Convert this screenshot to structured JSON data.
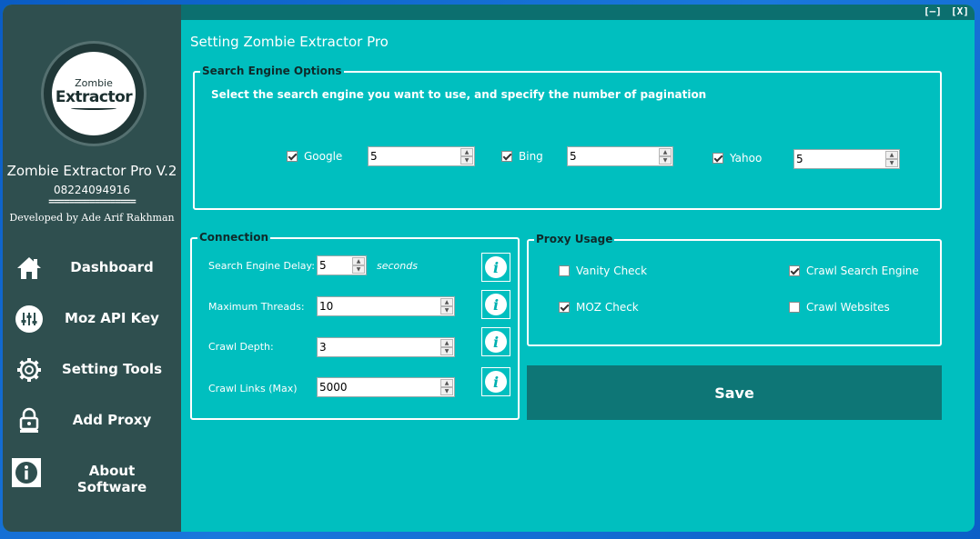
{
  "window": {
    "minimize_label": "[–]",
    "close_label": "[X]"
  },
  "sidebar": {
    "logo_small": "Zombie",
    "logo_big": "Extractor",
    "app_title": "Zombie Extractor Pro V.2",
    "phone": "08224094916",
    "separator": "=================",
    "developer": "Developed by Ade Arif Rakhman",
    "items": [
      {
        "label": "Dashboard",
        "icon": "home-icon"
      },
      {
        "label": "Moz API Key",
        "icon": "sliders-icon"
      },
      {
        "label": "Setting Tools",
        "icon": "gear-icon"
      },
      {
        "label": "Add Proxy",
        "icon": "proxy-lock-icon"
      },
      {
        "label": "About Software",
        "icon": "info-icon"
      }
    ]
  },
  "page_title": "Setting Zombie Extractor Pro",
  "search_engine": {
    "legend": "Search Engine Options",
    "instruction": "Select the search engine you want to use, and specify the number of pagination",
    "engines": [
      {
        "label": "Google",
        "checked": true,
        "pages": "5"
      },
      {
        "label": "Bing",
        "checked": true,
        "pages": "5"
      },
      {
        "label": "Yahoo",
        "checked": true,
        "pages": "5"
      }
    ]
  },
  "connection": {
    "legend": "Connection",
    "delay_label": "Search Engine Delay:",
    "delay_value": "5",
    "delay_unit": "seconds",
    "threads_label": "Maximum Threads:",
    "threads_value": "10",
    "depth_label": "Crawl Depth:",
    "depth_value": "3",
    "links_label": "Crawl Links (Max)",
    "links_value": "5000",
    "info_glyph": "i"
  },
  "proxy": {
    "legend": "Proxy Usage",
    "options": [
      {
        "label": "Vanity Check",
        "checked": false
      },
      {
        "label": "Crawl Search Engine",
        "checked": true
      },
      {
        "label": "MOZ Check",
        "checked": true
      },
      {
        "label": "Crawl Websites",
        "checked": false
      }
    ]
  },
  "save_label": "Save",
  "colors": {
    "sidebar": "#2f4f4f",
    "content": "#00bfbf",
    "topbar": "#0c6f6f",
    "save_button": "#0e7676",
    "desktop": "#1a78dc"
  }
}
